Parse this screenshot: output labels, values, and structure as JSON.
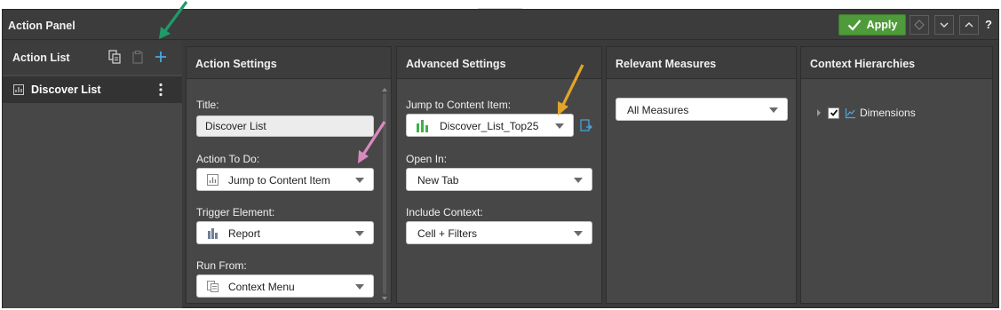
{
  "titlebar": {
    "title": "Action Panel",
    "apply_label": "Apply",
    "help_label": "?"
  },
  "icons": {
    "apply": "check-icon",
    "clear": "diamond-icon",
    "collapse": "chevron-down-icon",
    "expand": "chevron-up-icon",
    "duplicate": "duplicate-icon",
    "paste": "clipboard-icon",
    "add": "plus-icon"
  },
  "action_list": {
    "header": "Action List",
    "items": [
      {
        "label": "Discover List",
        "icon": "chart-icon"
      }
    ]
  },
  "action_settings": {
    "header": "Action Settings",
    "title_label": "Title:",
    "title_value": "Discover List",
    "action_label": "Action To Do:",
    "action_value": "Jump to Content Item",
    "trigger_label": "Trigger Element:",
    "trigger_value": "Report",
    "run_from_label": "Run From:",
    "run_from_value": "Context Menu"
  },
  "advanced_settings": {
    "header": "Advanced Settings",
    "jump_label": "Jump to Content Item:",
    "jump_value": "Discover_List_Top25",
    "open_in_label": "Open In:",
    "open_in_value": "New Tab",
    "context_label": "Include Context:",
    "context_value": "Cell + Filters"
  },
  "relevant_measures": {
    "header": "Relevant Measures",
    "value": "All Measures"
  },
  "context_hierarchies": {
    "header": "Context Hierarchies",
    "items": [
      {
        "label": "Dimensions",
        "checked": true
      }
    ]
  },
  "colors": {
    "apply_green": "#4f9a3a",
    "accent_blue": "#4aa8e0",
    "bar_green": "#3db24a",
    "arrow_green": "#1f9a6a",
    "arrow_pink": "#d98ac0",
    "arrow_orange": "#e2a52a"
  }
}
